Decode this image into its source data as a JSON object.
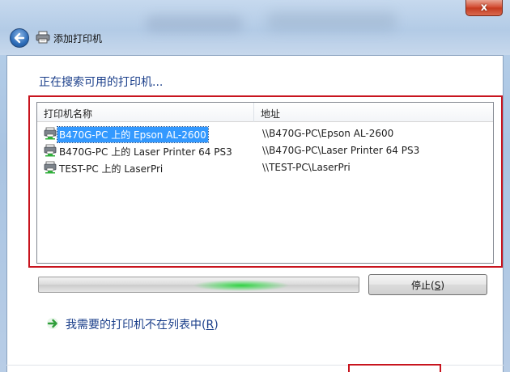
{
  "window": {
    "title": "添加打印机",
    "close_label": "x"
  },
  "heading": "正在搜索可用的打印机...",
  "table": {
    "columns": [
      "打印机名称",
      "地址"
    ],
    "rows": [
      {
        "name": "B470G-PC 上的 Epson AL-2600",
        "address": "\\\\B470G-PC\\Epson AL-2600",
        "selected": true
      },
      {
        "name": "B470G-PC 上的 Laser Printer 64 PS3",
        "address": "\\\\B470G-PC\\Laser Printer 64 PS3",
        "selected": false
      },
      {
        "name": "TEST-PC 上的 LaserPri",
        "address": "\\\\TEST-PC\\LaserPri",
        "selected": false
      }
    ]
  },
  "progress": {
    "state": "searching (indeterminate)"
  },
  "stop_button": {
    "label_prefix": "停止(",
    "accel": "S",
    "label_suffix": ")"
  },
  "not_listed_link": {
    "label_prefix": "我需要的打印机不在列表中(",
    "accel": "R",
    "label_suffix": ")"
  },
  "colors": {
    "accent_text": "#1a3e8a",
    "selection": "#3399ff",
    "annotation_frame": "#c8141e",
    "progress_glow": "#2ed23c"
  },
  "icons": {
    "back": "back-arrow-icon",
    "title": "printer-icon",
    "row": "network-printer-icon",
    "link": "green-arrow-icon",
    "close": "close-icon"
  }
}
